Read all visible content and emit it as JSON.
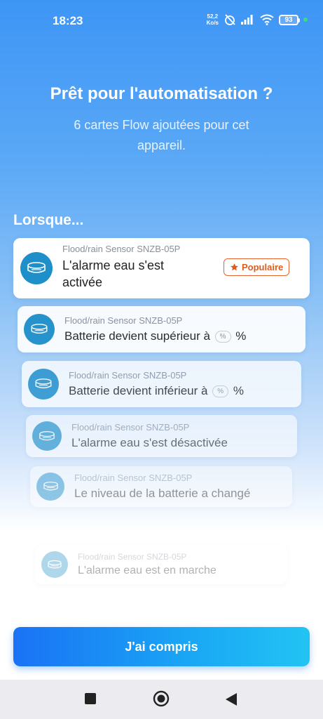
{
  "status": {
    "time": "18:23",
    "net_speed_value": "52,2",
    "net_speed_unit": "Ko/s",
    "battery": "93"
  },
  "header": {
    "title": "Prêt pour l'automatisation ?",
    "subtitle": "6 cartes Flow ajoutées pour cet appareil."
  },
  "section_label": "Lorsque...",
  "cards": [
    {
      "device": "Flood/rain Sensor SNZB-05P",
      "title": "L'alarme eau s'est activée",
      "badge": "Populaire"
    },
    {
      "device": "Flood/rain Sensor SNZB-05P",
      "title_before": "Batterie devient supérieur à",
      "pill": "%",
      "title_after": "%"
    },
    {
      "device": "Flood/rain Sensor SNZB-05P",
      "title_before": "Batterie devient inférieur à",
      "pill": "%",
      "title_after": "%"
    },
    {
      "device": "Flood/rain Sensor SNZB-05P",
      "title": "L'alarme eau s'est désactivée"
    },
    {
      "device": "Flood/rain Sensor SNZB-05P",
      "title": "Le niveau de la batterie a changé"
    },
    {
      "device": "Flood/rain Sensor SNZB-05P",
      "title": "L'alarme eau est en marche"
    }
  ],
  "cta_label": "J'ai compris",
  "icons": {
    "device": "sensor-icon",
    "badge": "star-icon",
    "nav": [
      "square-icon",
      "circle-icon",
      "back-triangle-icon"
    ]
  },
  "colors": {
    "accent": "#1a72f5",
    "badge": "#e05a1c",
    "device_icon": "#1e8fc9"
  }
}
